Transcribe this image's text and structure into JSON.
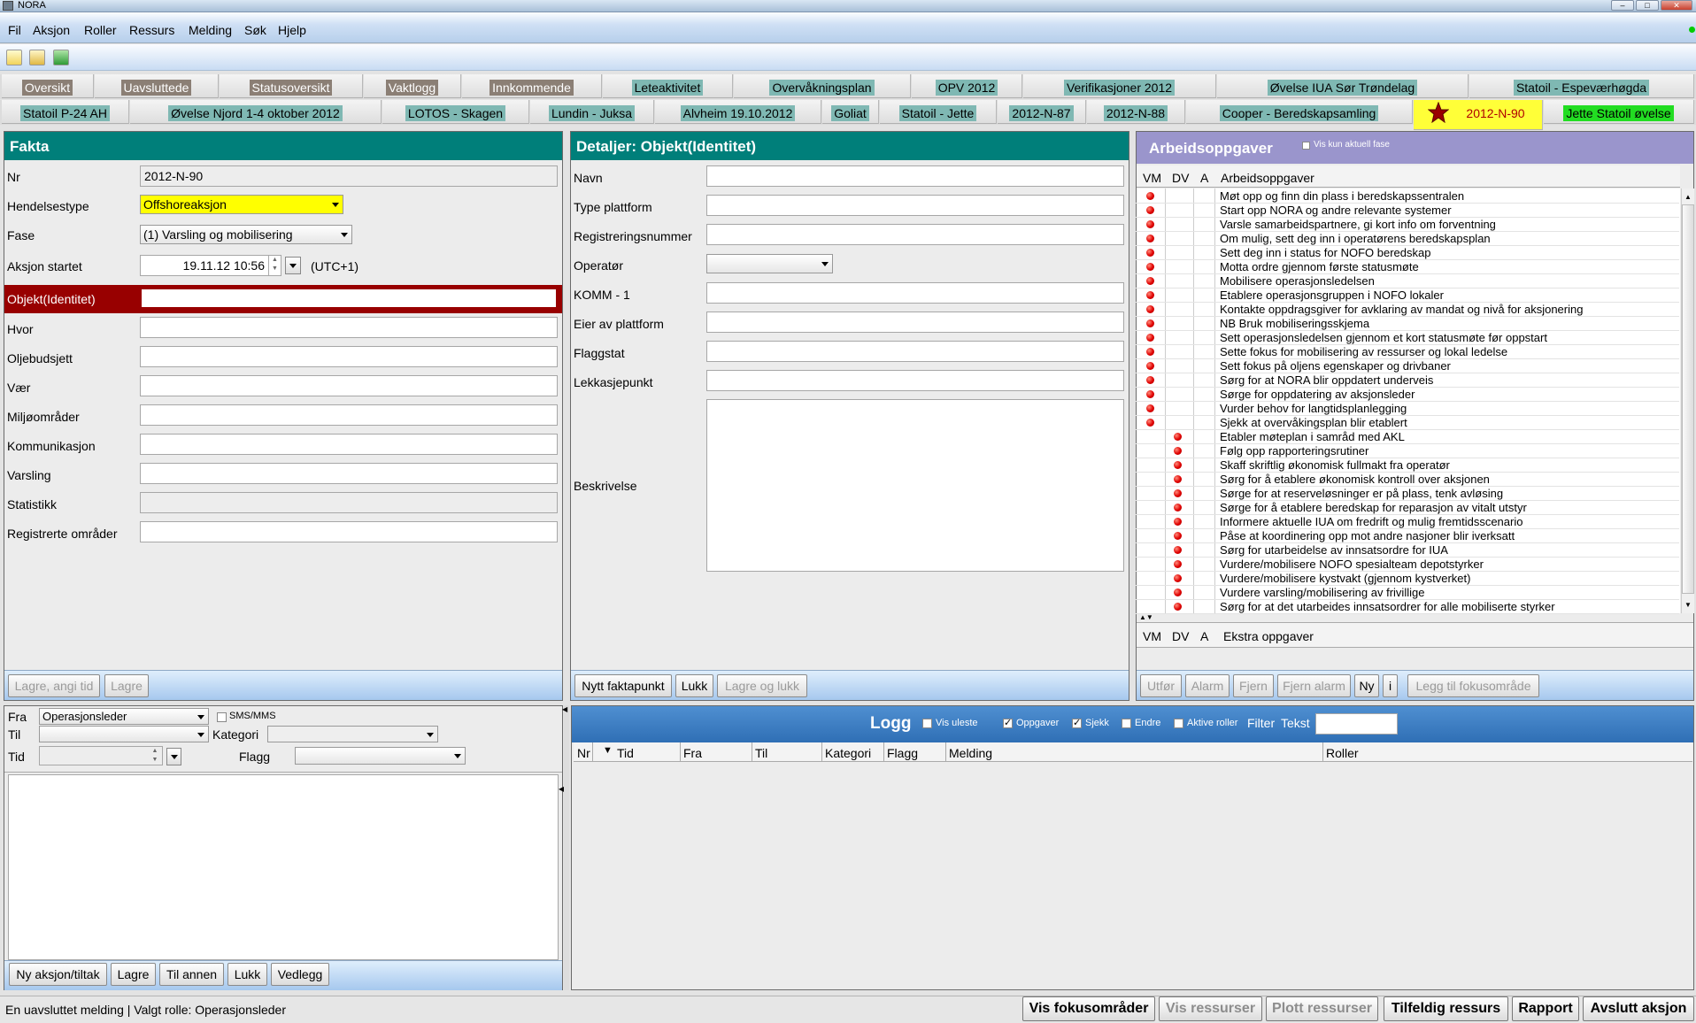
{
  "window": {
    "title": "NORA"
  },
  "menu": [
    "Fil",
    "Aksjon",
    "Roller",
    "Ressurs",
    "Melding",
    "Søk",
    "Hjelp"
  ],
  "tabs_row1": [
    "Oversikt",
    "Uavsluttede",
    "Statusoversikt",
    "Vaktlogg",
    "Innkommende",
    "Leteaktivitet",
    "Overvåkningsplan",
    "OPV 2012",
    "Verifikasjoner 2012",
    "Øvelse IUA Sør Trøndelag",
    "Statoil - Espeværhøgda"
  ],
  "tabs_row2": [
    "Statoil P-24 AH",
    "Øvelse Njord  1-4 oktober 2012",
    "LOTOS - Skagen",
    "Lundin - Juksa",
    "Alvheim 19.10.2012",
    "Goliat",
    "Statoil - Jette",
    "2012-N-87",
    "2012-N-88",
    "Cooper - Beredskapsamling",
    "2012-N-90",
    "Jette Statoil øvelse"
  ],
  "fakta": {
    "title": "Fakta",
    "nr_label": "Nr",
    "nr_value": "2012-N-90",
    "hendelsestype_label": "Hendelsestype",
    "hendelsestype_value": "Offshoreaksjon",
    "fase_label": "Fase",
    "fase_value": "(1) Varsling og mobilisering",
    "aksjon_label": "Aksjon startet",
    "aksjon_value": "19.11.12 10:56",
    "aksjon_tz": "(UTC+1)",
    "objekt_label": "Objekt(Identitet)",
    "hvor_label": "Hvor",
    "oljebudsjett_label": "Oljebudsjett",
    "vaer_label": "Vær",
    "miljo_label": "Miljøområder",
    "kommunikasjon_label": "Kommunikasjon",
    "varsling_label": "Varsling",
    "statistikk_label": "Statistikk",
    "registrerte_label": "Registrerte områder",
    "btn_lagre_tid": "Lagre, angi tid",
    "btn_lagre": "Lagre"
  },
  "detaljer": {
    "title": "Detaljer: Objekt(Identitet)",
    "labels": [
      "Navn",
      "Type plattform",
      "Registreringsnummer",
      "Operatør",
      "KOMM - 1",
      "Eier av plattform",
      "Flaggstat",
      "Lekkasjepunkt"
    ],
    "beskrivelse_label": "Beskrivelse",
    "btn_nytt": "Nytt faktapunkt",
    "btn_lukk": "Lukk",
    "btn_lagre_lukk": "Lagre og lukk"
  },
  "arbeid": {
    "title": "Arbeidsoppgaver",
    "vis_kun": "Vis kun aktuell fase",
    "col_vm": "VM",
    "col_dv": "DV",
    "col_a": "A",
    "col_task": "Arbeidsoppgaver",
    "col_extra": "Ekstra oppgaver",
    "tasks_vm": [
      "Møt opp og finn din plass i beredskapssentralen",
      "Start opp NORA og andre relevante systemer",
      "Varsle samarbeidspartnere, gi kort info om forventning",
      "Om mulig, sett deg inn i operatørens beredskapsplan",
      "Sett deg inn i status for NOFO beredskap",
      "Motta ordre gjennom første statusmøte",
      "Mobilisere operasjonsledelsen",
      "Etablere operasjonsgruppen i NOFO lokaler",
      "Kontakte oppdragsgiver for avklaring av mandat og nivå for aksjonering",
      "NB Bruk mobiliseringsskjema",
      "Sett operasjonsledelsen gjennom et kort statusmøte før oppstart",
      "Sette fokus for mobilisering av ressurser og lokal ledelse",
      "Sett fokus på oljens egenskaper og drivbaner",
      "Sørg for at NORA blir oppdatert underveis",
      "Sørge for oppdatering av aksjonsleder",
      "Vurder behov for langtidsplanlegging",
      "Sjekk at overvåkingsplan blir etablert"
    ],
    "tasks_dv": [
      "Etabler møteplan i samråd med AKL",
      "Følg opp rapporteringsrutiner",
      "Skaff skriftlig økonomisk fullmakt fra operatør",
      "Sørg for å etablere økonomisk kontroll over aksjonen",
      "Sørge for at reserveløsninger er på plass, tenk avløsing",
      "Sørge for å etablere beredskap for reparasjon av vitalt utstyr",
      "Informere aktuelle IUA om fredrift og mulig fremtidsscenario",
      "Påse at koordinering opp mot andre nasjoner blir iverksatt",
      "Sørg for utarbeidelse av innsatsordre for IUA",
      "Vurdere/mobilisere NOFO spesialteam depotstyrker",
      "Vurdere/mobilisere kystvakt (gjennom kystverket)",
      "Vurdere varsling/mobilisering av frivillige",
      "Sørg for at det utarbeides innsatsordrer for alle mobiliserte styrker"
    ],
    "btns": [
      "Utfør",
      "Alarm",
      "Fjern",
      "Fjern alarm",
      "Ny",
      "i",
      "Legg til fokusområde"
    ]
  },
  "melding": {
    "fra_label": "Fra",
    "fra_value": "Operasjonsleder",
    "sms": "SMS/MMS",
    "til_label": "Til",
    "kategori_label": "Kategori",
    "tid_label": "Tid",
    "flagg_label": "Flagg",
    "btns": [
      "Ny aksjon/tiltak",
      "Lagre",
      "Til annen",
      "Lukk",
      "Vedlegg"
    ]
  },
  "logg": {
    "title": "Logg",
    "vis_uleste": "Vis uleste",
    "oppgaver": "Oppgaver",
    "sjekk": "Sjekk",
    "endre": "Endre",
    "aktive_roller": "Aktive roller",
    "filter": "Filter",
    "tekst": "Tekst",
    "columns": [
      "Nr",
      "Tid",
      "Fra",
      "Til",
      "Kategori",
      "Flagg",
      "Melding",
      "Roller"
    ]
  },
  "status": {
    "text": "En uavsluttet melding | Valgt rolle: Operasjonsleder",
    "btns": [
      "Vis fokusområder",
      "Vis ressurser",
      "Plott ressurser",
      "Tilfeldig ressurs",
      "Rapport",
      "Avslutt aksjon"
    ]
  },
  "colors": {
    "teal": "#007f7a",
    "lilac": "#9a95cc",
    "objekt_red": "#980000",
    "hendelse_yellow": "#ffff00",
    "active_tab": "#ffff38",
    "green_tab": "#22dd22"
  }
}
